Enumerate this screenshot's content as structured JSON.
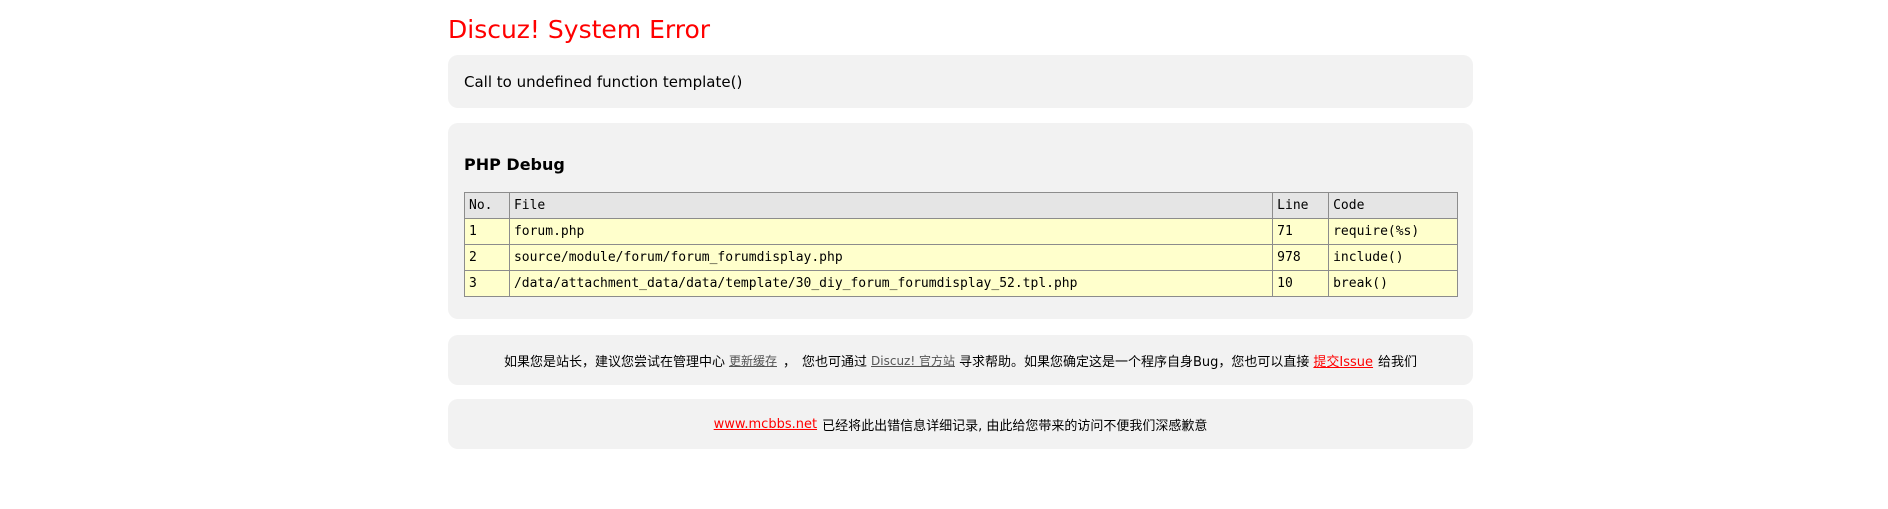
{
  "title": "Discuz! System Error",
  "error_message": "Call to undefined function template()",
  "debug": {
    "title": "PHP Debug",
    "headers": {
      "no": "No.",
      "file": "File",
      "line": "Line",
      "code": "Code"
    },
    "rows": [
      {
        "no": "1",
        "file": "forum.php",
        "line": "71",
        "code": "require(%s)"
      },
      {
        "no": "2",
        "file": "source/module/forum/forum_forumdisplay.php",
        "line": "978",
        "code": "include()"
      },
      {
        "no": "3",
        "file": "/data/attachment_data/data/template/30_diy_forum_forumdisplay_52.tpl.php",
        "line": "10",
        "code": "break()"
      }
    ]
  },
  "help": {
    "text1": "如果您是站长，建议您尝试在管理中心",
    "link_cache": "更新缓存",
    "sep": "，",
    "text2": "您也可通过",
    "link_official": "Discuz! 官方站",
    "text3": "寻求帮助。如果您确定这是一个程序自身Bug，您也可以直接",
    "link_issue": "提交Issue",
    "text4": "给我们"
  },
  "footer": {
    "site_link": "www.mcbbs.net",
    "text": "已经将此出错信息详细记录, 由此给您带来的访问不便我们深感歉意"
  },
  "colors": {
    "title": "#ff0000",
    "box_bg": "#f2f2f2",
    "row_bg": "#ffffcc",
    "header_bg": "#e5e5e5"
  }
}
